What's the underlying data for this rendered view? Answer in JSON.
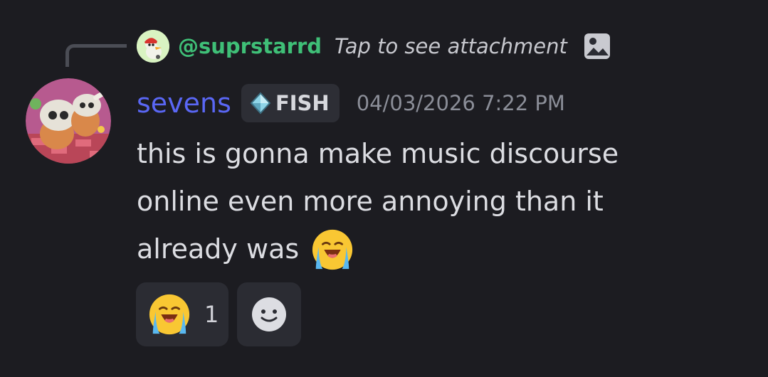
{
  "reply": {
    "avatar_icon": "duck-avatar",
    "username": "@suprstarrd",
    "text": "Tap to see attachment",
    "attachment_icon": "image-icon"
  },
  "message": {
    "avatar_icon": "cubone-avatar",
    "username": "sevens",
    "username_color": "#5a67f5",
    "tag": {
      "icon": "diamond-icon",
      "label": "FISH"
    },
    "timestamp": "04/03/2026 7:22 PM",
    "body": "this is gonna make music discourse online even more annoying than it already was",
    "body_emoji": "loudly-crying-face"
  },
  "reactions": [
    {
      "emoji": "loudly-crying-face",
      "count": "1"
    }
  ],
  "add_reaction_icon": "smile-icon"
}
